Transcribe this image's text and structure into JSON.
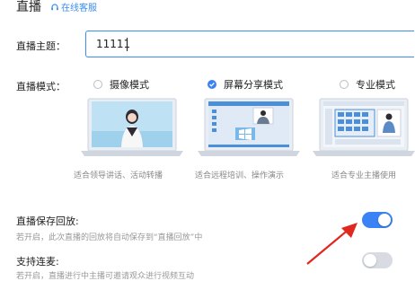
{
  "header": {
    "title": "直播",
    "service_label": "在线客服"
  },
  "topic": {
    "label": "直播主题：",
    "value": "11111"
  },
  "mode": {
    "label": "直播模式：",
    "options": [
      {
        "label": "摄像模式",
        "selected": false
      },
      {
        "label": "屏幕分享模式",
        "selected": true
      },
      {
        "label": "专业模式",
        "selected": false
      }
    ],
    "captions": [
      "适合领导讲话、活动转播",
      "适合远程培训、操作演示",
      "适合专业主播使用"
    ]
  },
  "settings": {
    "save_replay": {
      "label": "直播保存回放:",
      "desc": "若开启，此次直播的回放将自动保存到“直播回放”中",
      "enabled": true
    },
    "co_host": {
      "label": "支持连麦:",
      "desc": "若开启，直播进行中主播可邀请观众进行视频互动",
      "enabled": false
    }
  },
  "colors": {
    "accent": "#3b82f6",
    "annotation_arrow": "#e0281f",
    "toggle_off": "#d8dce2"
  },
  "icons": {
    "service": "headset-icon",
    "selected_radio": "check-circle-icon",
    "annotation": "red-arrow-icon"
  }
}
